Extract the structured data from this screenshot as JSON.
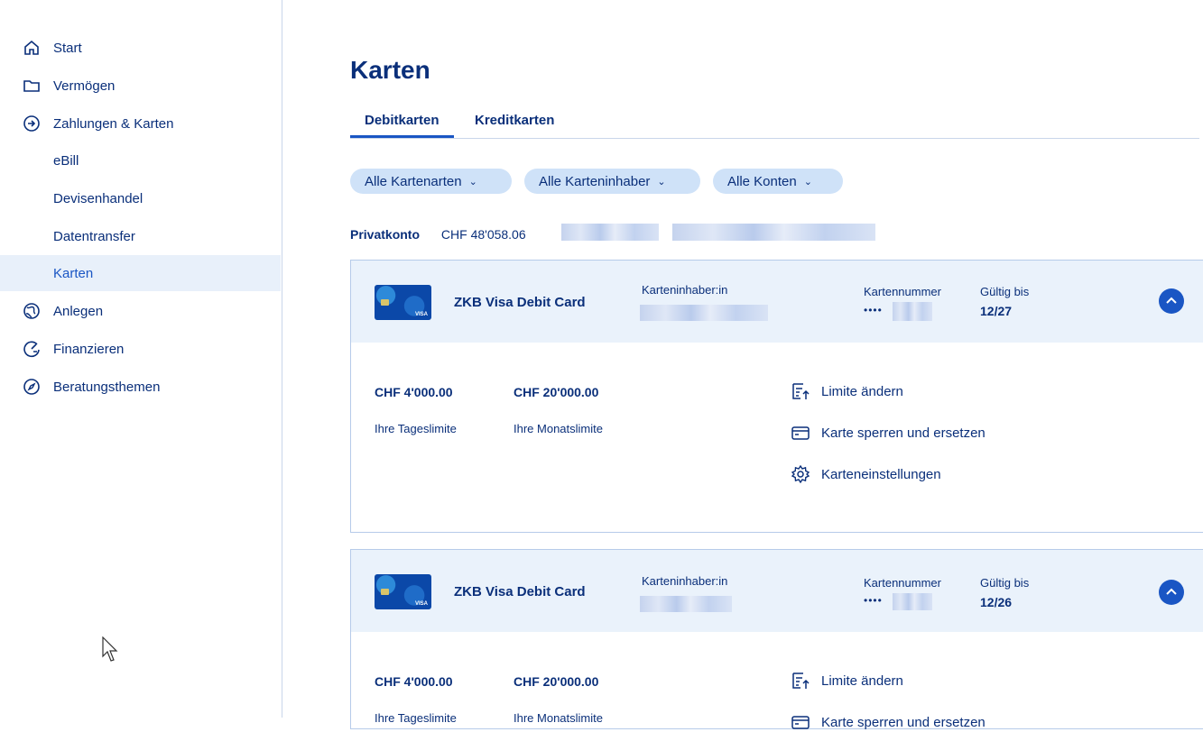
{
  "sidebar": {
    "items": [
      {
        "label": "Start",
        "icon": "home-icon"
      },
      {
        "label": "Vermögen",
        "icon": "folder-icon"
      },
      {
        "label": "Zahlungen & Karten",
        "icon": "arrow-circle-icon"
      },
      {
        "label": "eBill"
      },
      {
        "label": "Devisenhandel"
      },
      {
        "label": "Datentransfer"
      },
      {
        "label": "Karten",
        "active": true
      },
      {
        "label": "Anlegen",
        "icon": "globe-icon"
      },
      {
        "label": "Finanzieren",
        "icon": "dial-icon"
      },
      {
        "label": "Beratungsthemen",
        "icon": "compass-icon"
      }
    ]
  },
  "main": {
    "title": "Karten",
    "tabs": [
      {
        "label": "Debitkarten",
        "active": true
      },
      {
        "label": "Kreditkarten"
      }
    ],
    "filters": [
      "Alle Kartenarten",
      "Alle Karteninhaber",
      "Alle Konten"
    ],
    "account": {
      "name": "Privatkonto",
      "balance": "CHF 48'058.06"
    },
    "cards": [
      {
        "name": "ZKB Visa Debit Card",
        "holder_label": "Karteninhaber:in",
        "number_label": "Kartennummer",
        "number_dots": "••••",
        "valid_label": "Gültig bis",
        "valid": "12/27",
        "daily_amount": "CHF 4'000.00",
        "daily_label": "Ihre Tageslimite",
        "monthly_amount": "CHF 20'000.00",
        "monthly_label": "Ihre Monatslimite",
        "actions": [
          "Limite ändern",
          "Karte sperren und ersetzen",
          "Karteneinstellungen"
        ]
      },
      {
        "name": "ZKB Visa Debit Card",
        "holder_label": "Karteninhaber:in",
        "number_label": "Kartennummer",
        "number_dots": "••••",
        "valid_label": "Gültig bis",
        "valid": "12/26",
        "daily_amount": "CHF 4'000.00",
        "daily_label": "Ihre Tageslimite",
        "monthly_amount": "CHF 20'000.00",
        "monthly_label": "Ihre Monatslimite",
        "actions": [
          "Limite ändern",
          "Karte sperren und ersetzen"
        ]
      }
    ]
  },
  "colors": {
    "primary": "#0a2f7a",
    "accent": "#1a56c4",
    "highlight": "#e8f0fa",
    "chip": "#cfe2f8"
  }
}
